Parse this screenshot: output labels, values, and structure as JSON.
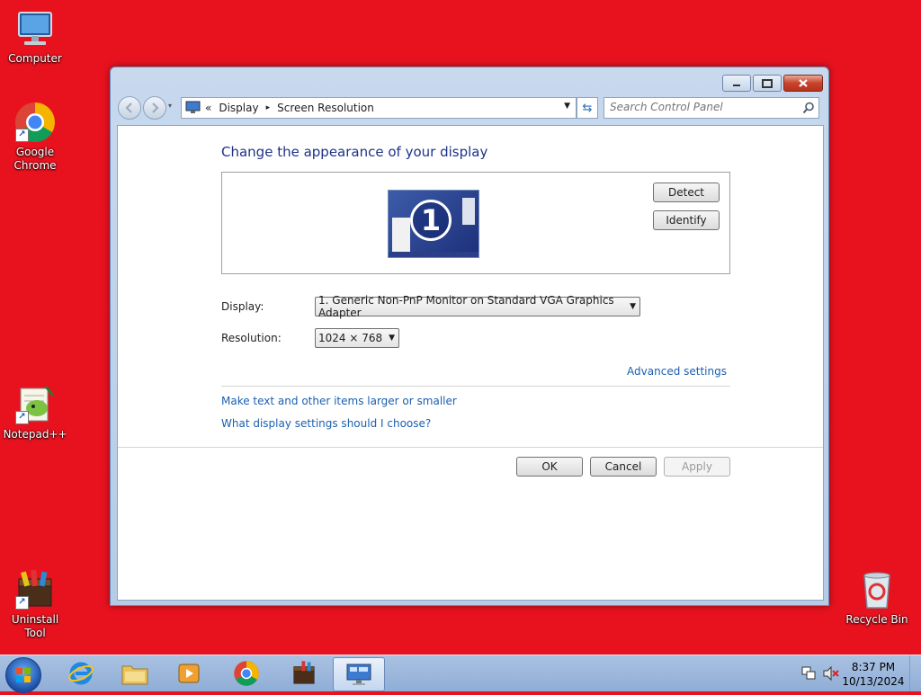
{
  "desktop": {
    "icons": [
      {
        "label": "Computer"
      },
      {
        "label": "Google Chrome"
      },
      {
        "label": "Notepad++"
      },
      {
        "label": "Uninstall Tool"
      },
      {
        "label": "Recycle Bin"
      }
    ]
  },
  "window": {
    "breadcrumb": {
      "prefix": "«",
      "display": "Display",
      "separator": "▸",
      "current": "Screen Resolution"
    },
    "search_placeholder": "Search Control Panel",
    "heading": "Change the appearance of your display",
    "monitor_number": "1",
    "detect_label": "Detect",
    "identify_label": "Identify",
    "display_label": "Display:",
    "display_value": "1. Generic Non-PnP Monitor on Standard VGA Graphics Adapter",
    "resolution_label": "Resolution:",
    "resolution_value": "1024 × 768",
    "advanced_settings": "Advanced settings",
    "link_larger": "Make text and other items larger or smaller",
    "link_choose": "What display settings should I choose?",
    "ok_label": "OK",
    "cancel_label": "Cancel",
    "apply_label": "Apply"
  },
  "taskbar": {
    "time": "8:37 PM",
    "date": "10/13/2024"
  },
  "colors": {
    "desktop_bg": "#e8121f",
    "heading": "#1e3287",
    "link": "#1b5fb0"
  }
}
